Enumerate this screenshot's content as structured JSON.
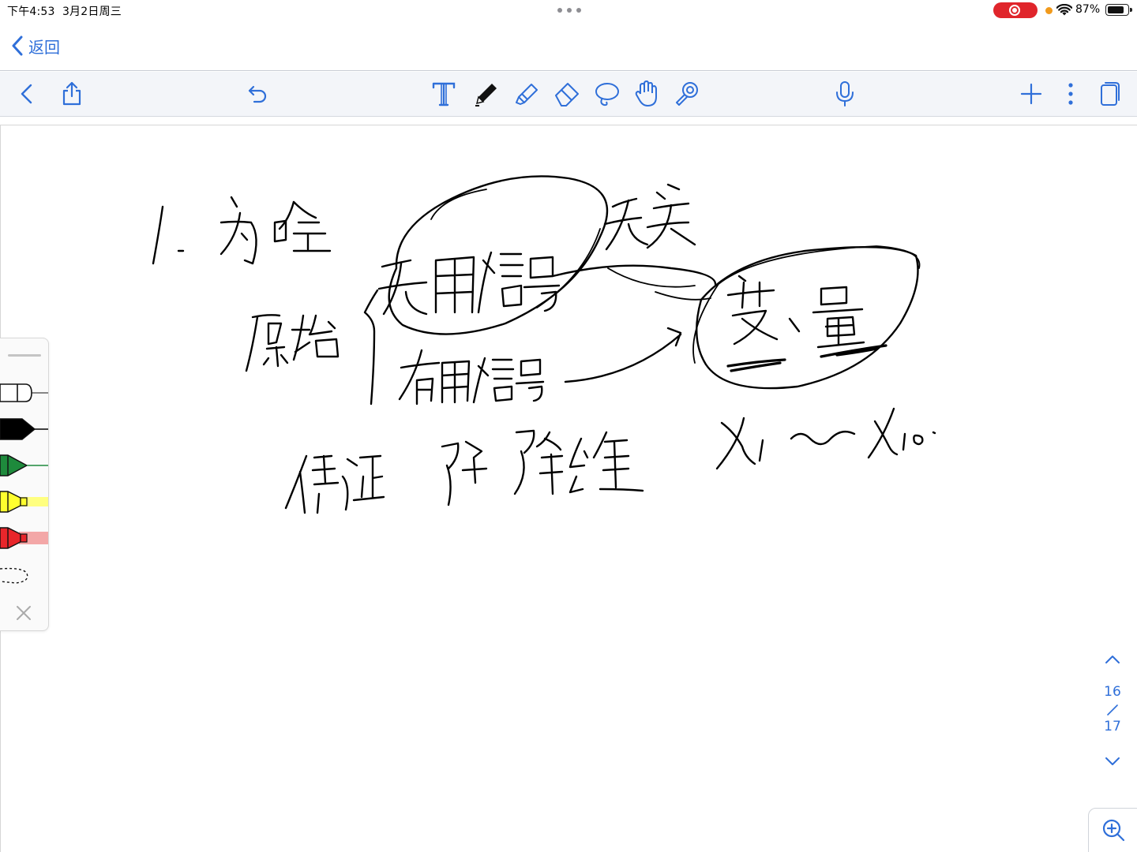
{
  "status_bar": {
    "time": "下午4:53",
    "date": "3月2日周三",
    "battery_percent": "87%",
    "battery_level": 0.87,
    "recording_color": "#e0252b",
    "indicator_color": "#f19a1c"
  },
  "nav": {
    "back_label": "返回",
    "accent_color": "#2f6fd9"
  },
  "toolbar": {
    "left_tools": [
      "back-chevron-icon",
      "share-icon",
      "undo-icon"
    ],
    "drawing_tools": [
      "text-tool-icon",
      "pen-tool-icon",
      "highlighter-tool-icon",
      "eraser-tool-icon",
      "lasso-tool-icon",
      "hand-tool-icon",
      "laser-pointer-icon"
    ],
    "selected_tool": "pen-tool-icon",
    "right_tools": [
      "microphone-icon",
      "add-page-icon",
      "more-icon",
      "pages-icon"
    ]
  },
  "pen_palette": {
    "pens": [
      {
        "name": "white-pen",
        "color": "#ffffff"
      },
      {
        "name": "black-pen",
        "color": "#000000"
      },
      {
        "name": "green-pen",
        "color": "#1e8a3c"
      },
      {
        "name": "yellow-highlighter",
        "color": "#ffff2e"
      },
      {
        "name": "red-highlighter",
        "color": "#e8262b"
      }
    ]
  },
  "page_navigator": {
    "current_page": "16",
    "total_pages": "17"
  }
}
